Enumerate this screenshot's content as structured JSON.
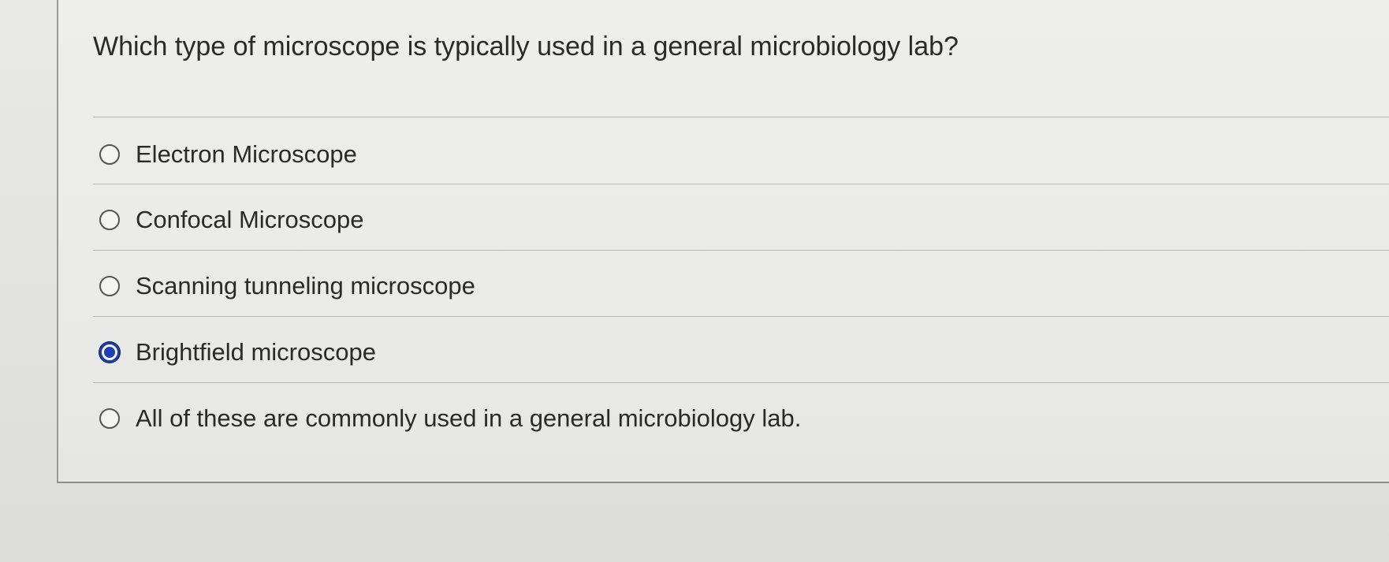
{
  "question": {
    "text": "Which type of microscope is typically used in a general microbiology lab?"
  },
  "options": [
    {
      "label": "Electron Microscope",
      "selected": false
    },
    {
      "label": "Confocal Microscope",
      "selected": false
    },
    {
      "label": "Scanning tunneling microscope",
      "selected": false
    },
    {
      "label": "Brightfield microscope",
      "selected": true
    },
    {
      "label": "All of these are commonly used in a general microbiology lab.",
      "selected": false
    }
  ],
  "colors": {
    "selected_radio": "#1d3fb0",
    "text": "#2a2a2a"
  }
}
